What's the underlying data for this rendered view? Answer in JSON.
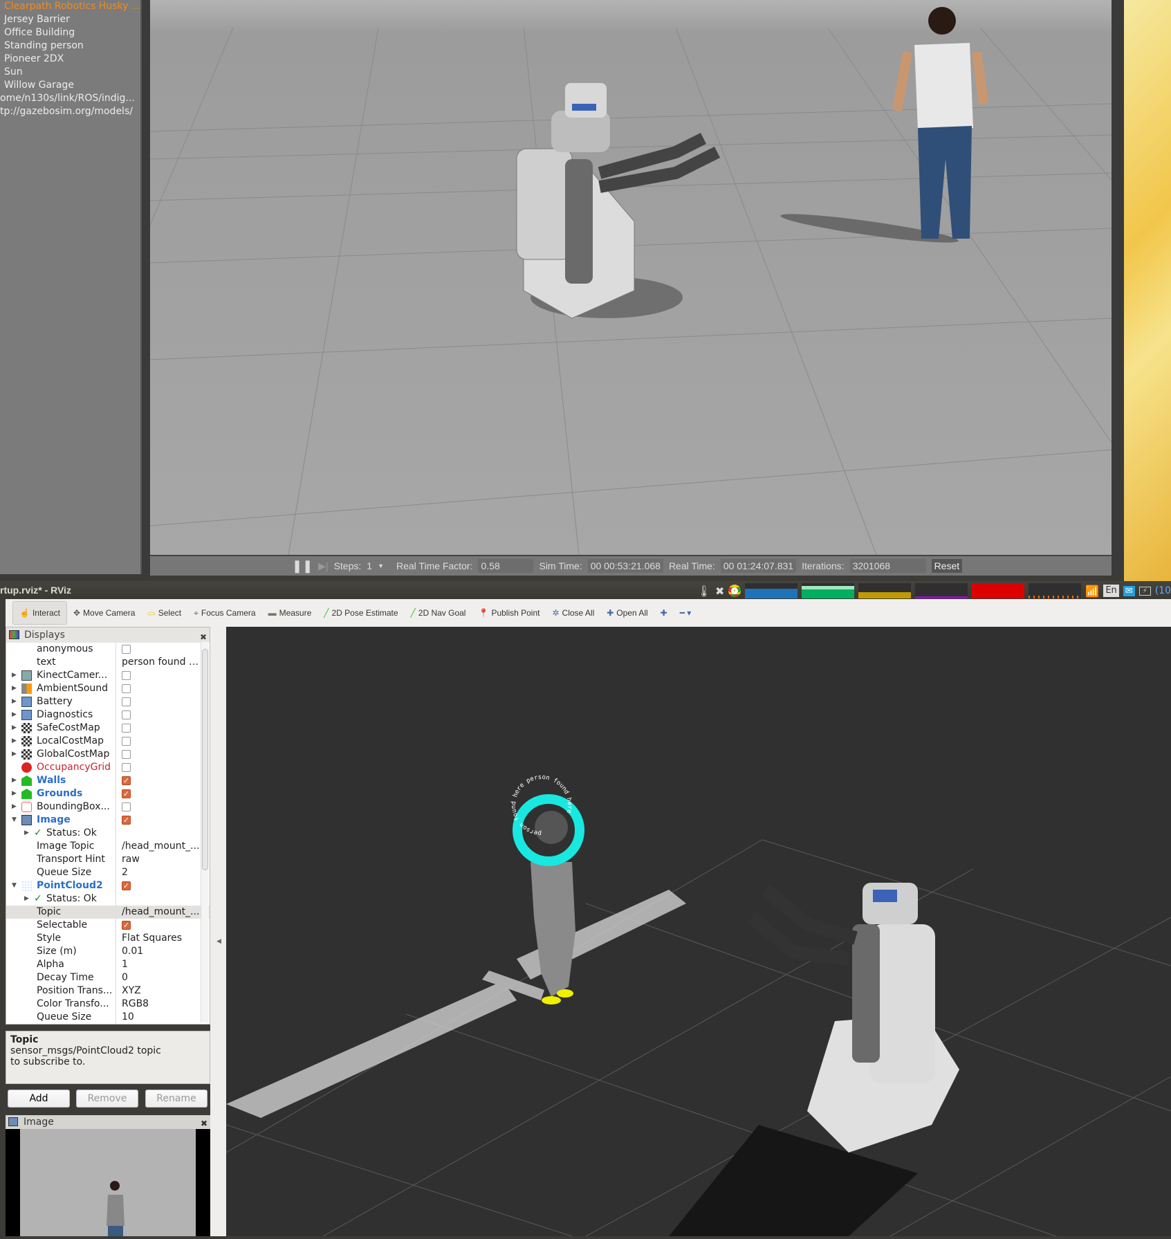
{
  "gazebo": {
    "model_list": [
      {
        "label": "Clearpath Robotics Husky ...",
        "selected": true
      },
      {
        "label": "Jersey Barrier"
      },
      {
        "label": "Office Building"
      },
      {
        "label": "Standing person"
      },
      {
        "label": "Pioneer 2DX"
      },
      {
        "label": "Sun"
      },
      {
        "label": "Willow Garage"
      },
      {
        "label": "ome/n130s/link/ROS/indig..."
      },
      {
        "label": "tp://gazebosim.org/models/"
      }
    ],
    "toolbar": {
      "steps_label": "Steps:",
      "steps_value": "1",
      "rtf_label": "Real Time Factor:",
      "rtf_value": "0.58",
      "sim_time_label": "Sim Time:",
      "sim_time_value": "00 00:53:21.068",
      "real_time_label": "Real Time:",
      "real_time_value": "00 01:24:07.831",
      "iterations_label": "Iterations:",
      "iterations_value": "3201068",
      "reset_label": "Reset"
    }
  },
  "window": {
    "title": "rtup.rviz* - RViz"
  },
  "tray": {
    "lang": "En",
    "battery": "(10"
  },
  "rviz": {
    "tools": [
      "Interact",
      "Move Camera",
      "Select",
      "Focus Camera",
      "Measure",
      "2D Pose Estimate",
      "2D Nav Goal",
      "Publish Point",
      "Close All",
      "Open All"
    ],
    "displays_title": "Displays",
    "rows": [
      {
        "name": "anonymous",
        "check": false,
        "indent": true
      },
      {
        "name": "text",
        "value": "person found h...",
        "indent": true
      },
      {
        "name": "KinectCamer...",
        "check": false,
        "arrow": "▶",
        "icon": "camera-icon"
      },
      {
        "name": "AmbientSound",
        "check": false,
        "arrow": "▶",
        "icon": "speaker-icon"
      },
      {
        "name": "Battery",
        "check": false,
        "arrow": "▶",
        "icon": "folder-icon"
      },
      {
        "name": "Diagnostics",
        "check": false,
        "arrow": "▶",
        "icon": "folder-icon"
      },
      {
        "name": "SafeCostMap",
        "check": false,
        "arrow": "▶",
        "icon": "grid-map-icon"
      },
      {
        "name": "LocalCostMap",
        "check": false,
        "arrow": "▶",
        "icon": "grid-map-icon"
      },
      {
        "name": "GlobalCostMap",
        "check": false,
        "arrow": "▶",
        "icon": "grid-map-icon"
      },
      {
        "name": "OccupancyGrid",
        "check": false,
        "icon": "error-icon",
        "style": "red"
      },
      {
        "name": "Walls",
        "check": true,
        "arrow": "▶",
        "icon": "marker-icon",
        "style": "blue"
      },
      {
        "name": "Grounds",
        "check": true,
        "arrow": "▶",
        "icon": "marker-icon",
        "style": "blue"
      },
      {
        "name": "BoundingBox...",
        "check": false,
        "arrow": "▶",
        "icon": "bbox-icon"
      },
      {
        "name": "Image",
        "check": true,
        "arrow": "▼",
        "icon": "image-icon",
        "style": "blue"
      },
      {
        "name": "Status: Ok",
        "arrow": "▶",
        "status": true
      },
      {
        "name": "Image Topic",
        "value": "/head_mount_...",
        "indent": true
      },
      {
        "name": "Transport Hint",
        "value": "raw",
        "indent": true
      },
      {
        "name": "Queue Size",
        "value": "2",
        "indent": true
      },
      {
        "name": "PointCloud2",
        "check": true,
        "arrow": "▼",
        "icon": "pointcloud-icon",
        "style": "blue"
      },
      {
        "name": "Status: Ok",
        "arrow": "▶",
        "status": true
      },
      {
        "name": "Topic",
        "value": "/head_mount_...",
        "indent": true,
        "highlight": true
      },
      {
        "name": "Selectable",
        "check": true,
        "indent": true
      },
      {
        "name": "Style",
        "value": "Flat Squares",
        "indent": true
      },
      {
        "name": "Size (m)",
        "value": "0.01",
        "indent": true
      },
      {
        "name": "Alpha",
        "value": "1",
        "indent": true
      },
      {
        "name": "Decay Time",
        "value": "0",
        "indent": true
      },
      {
        "name": "Position Trans...",
        "value": "XYZ",
        "indent": true
      },
      {
        "name": "Color Transfo...",
        "value": "RGB8",
        "indent": true
      },
      {
        "name": "Queue Size",
        "value": "10",
        "indent": true
      }
    ],
    "description": {
      "title": "Topic",
      "text": "sensor_msgs/PointCloud2 topic to subscribe to."
    },
    "buttons": {
      "add": "Add",
      "remove": "Remove",
      "rename": "Rename"
    },
    "image_panel_title": "Image",
    "marker_text": "person found here person found here "
  },
  "colors": {
    "accent_orange": "#e0673a",
    "cyan_marker": "#19e8e0",
    "feet_yellow": "#f0f000",
    "viewport_bg": "#303030"
  }
}
